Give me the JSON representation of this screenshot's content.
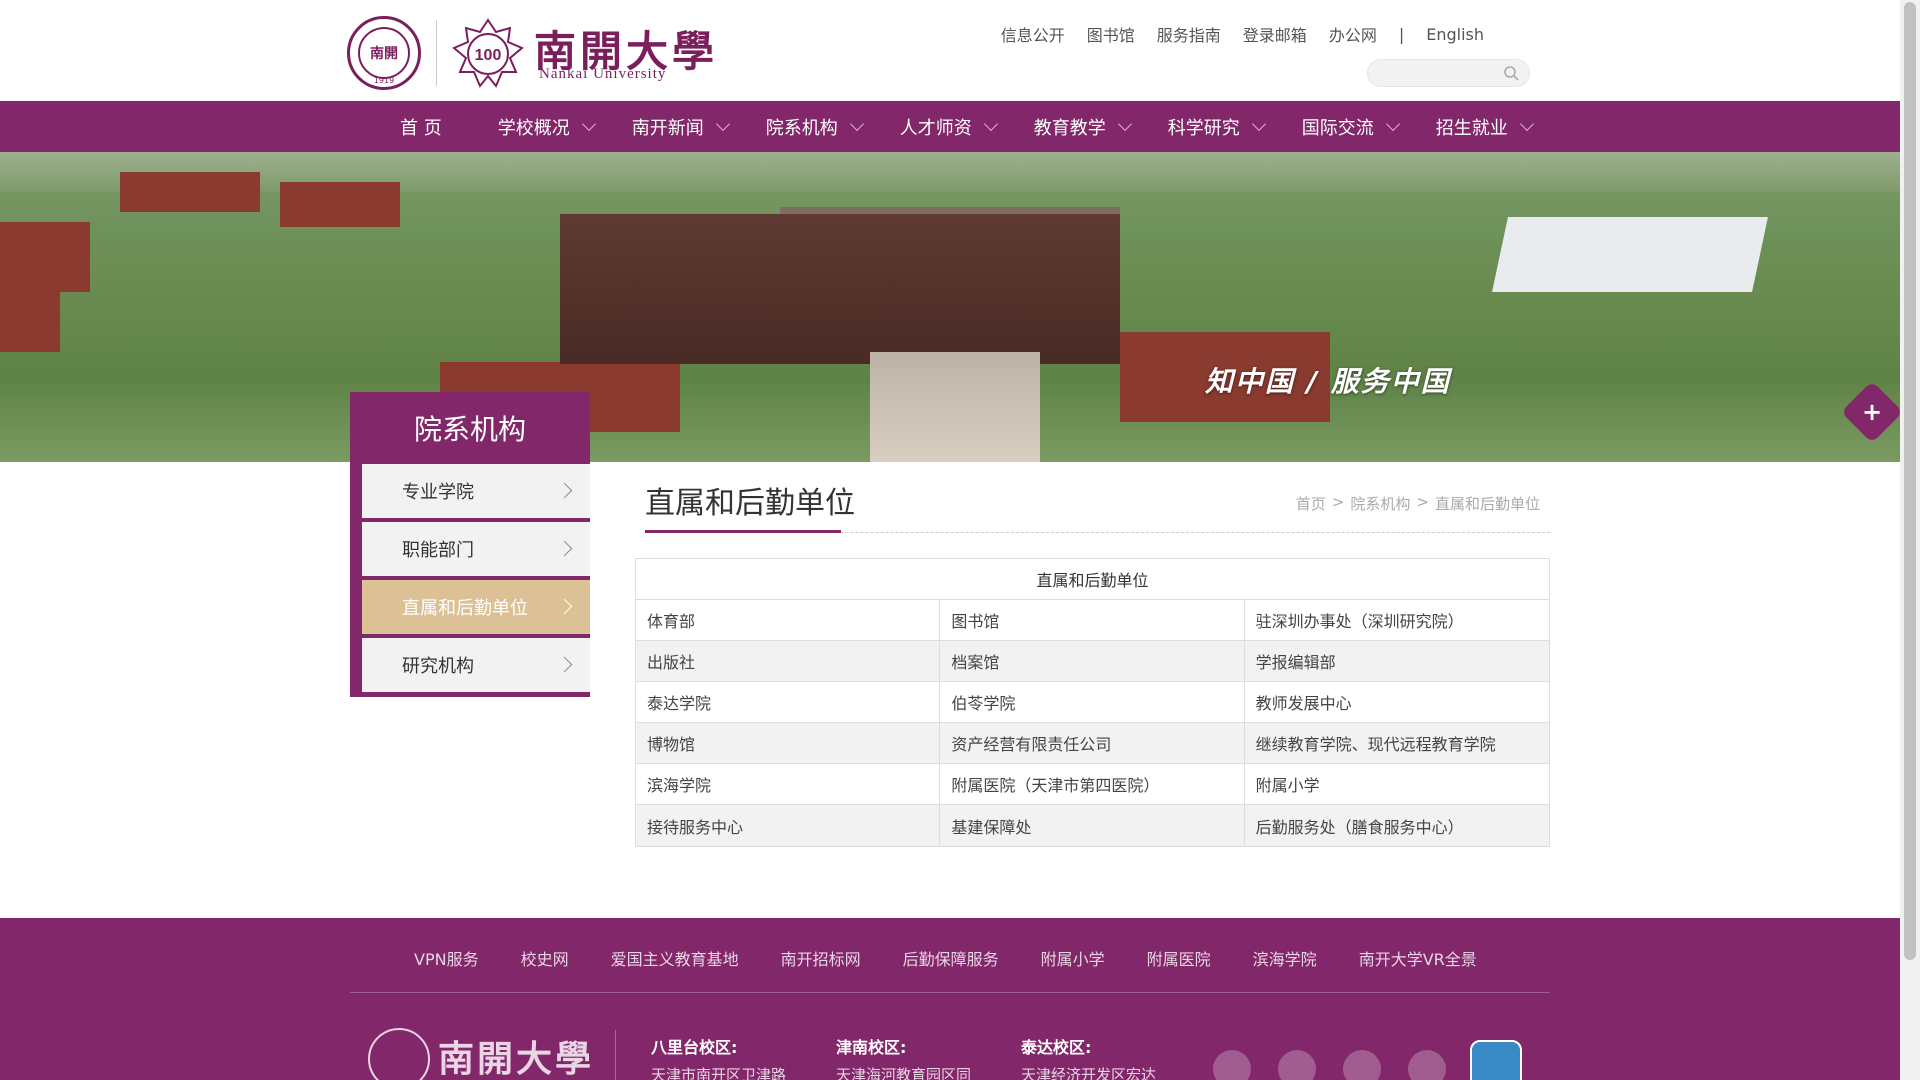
{
  "header": {
    "seal_text": "NANKAI UNIVERSITY",
    "seal_center": "南開",
    "seal_year": "1919",
    "badge_text": "100",
    "logo_cn": "南開大學",
    "logo_en": "Nankai University",
    "top_links": [
      "信息公开",
      "图书馆",
      "服务指南",
      "登录邮箱",
      "办公网"
    ],
    "separator": "|",
    "english_link": "English",
    "search_placeholder": ""
  },
  "nav": {
    "items": [
      {
        "label": "首 页",
        "has_dropdown": false
      },
      {
        "label": "学校概况",
        "has_dropdown": true
      },
      {
        "label": "南开新闻",
        "has_dropdown": true
      },
      {
        "label": "院系机构",
        "has_dropdown": true
      },
      {
        "label": "人才师资",
        "has_dropdown": true
      },
      {
        "label": "教育教学",
        "has_dropdown": true
      },
      {
        "label": "科学研究",
        "has_dropdown": true
      },
      {
        "label": "国际交流",
        "has_dropdown": true
      },
      {
        "label": "招生就业",
        "has_dropdown": true
      }
    ]
  },
  "banner": {
    "slogan": "知中国 / 服务中国",
    "plus_label": "+"
  },
  "sidebar": {
    "title": "院系机构",
    "items": [
      {
        "label": "专业学院",
        "active": false
      },
      {
        "label": "职能部门",
        "active": false
      },
      {
        "label": "直属和后勤单位",
        "active": true
      },
      {
        "label": "研究机构",
        "active": false
      }
    ]
  },
  "content": {
    "title": "直属和后勤单位",
    "breadcrumb": [
      "首页",
      ">",
      "院系机构",
      ">",
      "直属和后勤单位"
    ],
    "table": {
      "header": "直属和后勤单位",
      "rows": [
        [
          "体育部",
          "图书馆",
          "驻深圳办事处（深圳研究院）"
        ],
        [
          "出版社",
          "档案馆",
          "学报编辑部"
        ],
        [
          "泰达学院",
          "伯苓学院",
          "教师发展中心"
        ],
        [
          "博物馆",
          "资产经营有限责任公司",
          "继续教育学院、现代远程教育学院"
        ],
        [
          "滨海学院",
          "附属医院（天津市第四医院）",
          "附属小学"
        ],
        [
          "接待服务中心",
          "基建保障处",
          "后勤服务处（膳食服务中心）"
        ]
      ]
    }
  },
  "footer": {
    "links": [
      "VPN服务",
      "校史网",
      "爱国主义教育基地",
      "南开招标网",
      "后勤保障服务",
      "附属小学",
      "附属医院",
      "滨海学院",
      "南开大学VR全景"
    ],
    "logo_cn": "南開大學",
    "campuses": [
      {
        "name": "八里台校区:",
        "address": "天津市南开区卫津路"
      },
      {
        "name": "津南校区:",
        "address": "天津海河教育园区同"
      },
      {
        "name": "泰达校区:",
        "address": "天津经济开发区宏达"
      }
    ],
    "social_icons": [
      "wechat-icon",
      "weibo-icon",
      "douyin-icon",
      "bilibili-icon",
      "app-badge-icon"
    ]
  },
  "colors": {
    "brand": "#82276a",
    "active_sidebar": "#dcc197"
  }
}
